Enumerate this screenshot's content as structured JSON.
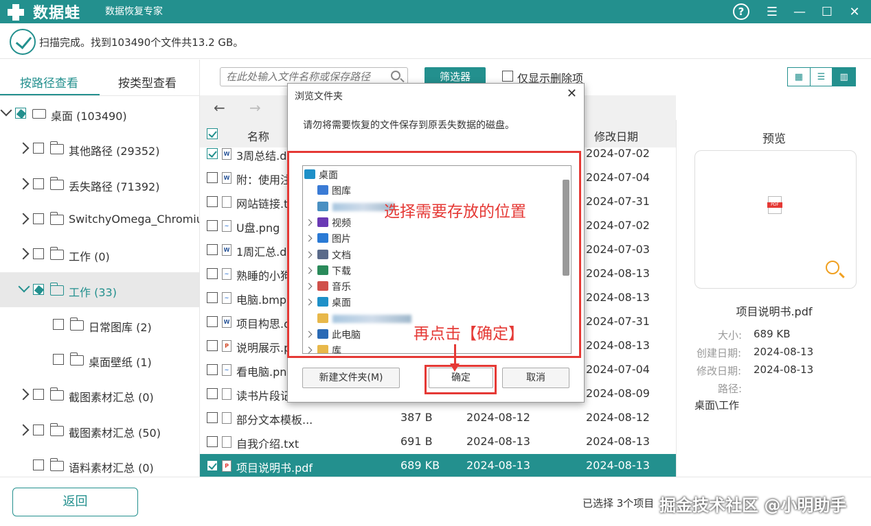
{
  "titlebar": {
    "app_name": "数据蛙",
    "subtitle": "数据恢复专家",
    "help": "?",
    "menu": "☰",
    "minimize": "—",
    "maximize": "☐",
    "close": "✕"
  },
  "status": {
    "scan_text": "扫描完成。找到103490个文件共13.2 GB。"
  },
  "left_tabs": {
    "by_path": "按路径查看",
    "by_type": "按类型查看"
  },
  "tree": [
    {
      "label": "桌面 (103490)",
      "expand": "down",
      "check": "partial",
      "icon": "drive"
    },
    {
      "label": "其他路径 (29352)",
      "expand": "right",
      "check": "none",
      "icon": "folder"
    },
    {
      "label": "丢失路径 (71392)",
      "expand": "right",
      "check": "none",
      "icon": "folder"
    },
    {
      "label": "SwitchyOmega_Chromium",
      "expand": "right",
      "check": "none",
      "icon": "folder"
    },
    {
      "label": "工作 (0)",
      "expand": "right",
      "check": "none",
      "icon": "folder"
    },
    {
      "label": "工作 (33)",
      "expand": "down",
      "check": "partial",
      "icon": "folder",
      "selected": true
    },
    {
      "label": "日常图库 (2)",
      "expand": "",
      "check": "none",
      "icon": "folder"
    },
    {
      "label": "桌面壁纸 (1)",
      "expand": "",
      "check": "none",
      "icon": "folder"
    },
    {
      "label": "截图素材汇总 (0)",
      "expand": "right",
      "check": "none",
      "icon": "folder"
    },
    {
      "label": "截图素材汇总 (50)",
      "expand": "right",
      "check": "none",
      "icon": "folder"
    },
    {
      "label": "语料素材汇总 (0)",
      "expand": "",
      "check": "none",
      "icon": "folder"
    }
  ],
  "search": {
    "placeholder": "在此处输入文件名称或保存路径"
  },
  "filter": {
    "label": "筛选器",
    "only_deleted": "仅显示删除项"
  },
  "view_icons": {
    "grid": "▦",
    "list": "☰",
    "detail": "▥"
  },
  "nav": {
    "back": "←",
    "forward": "→"
  },
  "columns": {
    "name": "名称",
    "modified": "修改日期"
  },
  "files": [
    {
      "name": "3周总结.d",
      "size": "",
      "created": "",
      "modified": "2024-07-02",
      "type": "W",
      "checked": true
    },
    {
      "name": "附：使用注",
      "size": "",
      "created": "",
      "modified": "2024-07-04",
      "type": "W",
      "checked": false
    },
    {
      "name": "网站链接.t",
      "size": "",
      "created": "",
      "modified": "2024-07-31",
      "type": "",
      "checked": false
    },
    {
      "name": "U盘.png",
      "size": "",
      "created": "",
      "modified": "2024-07-02",
      "type": "~",
      "checked": false
    },
    {
      "name": "1周汇总.d",
      "size": "",
      "created": "",
      "modified": "2024-07-03",
      "type": "W",
      "checked": false
    },
    {
      "name": "熟睡的小狗",
      "size": "",
      "created": "",
      "modified": "2024-08-13",
      "type": "~",
      "checked": false
    },
    {
      "name": "电脑.bmp",
      "size": "",
      "created": "",
      "modified": "2024-08-13",
      "type": "~",
      "checked": false
    },
    {
      "name": "项目构思.d",
      "size": "",
      "created": "",
      "modified": "2024-07-31",
      "type": "W",
      "checked": false
    },
    {
      "name": "说明展示.p",
      "size": "",
      "created": "",
      "modified": "2024-08-13",
      "type": "P",
      "checked": false
    },
    {
      "name": "看电脑.png",
      "size": "",
      "created": "",
      "modified": "2024-07-04",
      "type": "~",
      "checked": false
    },
    {
      "name": "读书片段记",
      "size": "",
      "created": "",
      "modified": "2024-08-09",
      "type": "",
      "checked": false
    },
    {
      "name": "部分文本模板...",
      "size": "387  B",
      "created": "2024-08-12",
      "modified": "2024-08-12",
      "type": "",
      "checked": false
    },
    {
      "name": "自我介绍.txt",
      "size": "691  B",
      "created": "2024-08-13",
      "modified": "2024-08-13",
      "type": "",
      "checked": false
    },
    {
      "name": "项目说明书.pdf",
      "size": "689 KB",
      "created": "2024-08-13",
      "modified": "2024-08-13",
      "type": "PDF",
      "checked": true,
      "selected": true
    }
  ],
  "preview": {
    "title": "预览",
    "filename": "项目说明书.pdf",
    "size_label": "大小:",
    "size": "689 KB",
    "created_label": "创建日期:",
    "created": "2024-08-13",
    "modified_label": "修改日期:",
    "modified": "2024-08-13",
    "path_label": "路径:",
    "path": "桌面\\工作"
  },
  "bottom": {
    "back": "返回",
    "selection": "已选择 3个项目",
    "watermark": "掘金技术社区 @小明助手"
  },
  "dialog": {
    "title": "浏览文件夹",
    "close": "✕",
    "message": "请勿将需要恢复的文件保存到原丢失数据的磁盘。",
    "tree": [
      {
        "label": "桌面",
        "level": 0,
        "expand": false,
        "icon": "desktop"
      },
      {
        "label": "图库",
        "level": 1,
        "expand": false,
        "icon": "gallery"
      },
      {
        "label": "",
        "level": 1,
        "expand": false,
        "icon": "user",
        "blurred": true
      },
      {
        "label": "视频",
        "level": 1,
        "expand": true,
        "icon": "video"
      },
      {
        "label": "图片",
        "level": 1,
        "expand": true,
        "icon": "pictures"
      },
      {
        "label": "文档",
        "level": 1,
        "expand": true,
        "icon": "docs"
      },
      {
        "label": "下载",
        "level": 1,
        "expand": true,
        "icon": "download"
      },
      {
        "label": "音乐",
        "level": 1,
        "expand": true,
        "icon": "music"
      },
      {
        "label": "桌面",
        "level": 1,
        "expand": true,
        "icon": "desktop"
      },
      {
        "label": "",
        "level": 1,
        "expand": false,
        "icon": "folder",
        "blurred": true
      },
      {
        "label": "此电脑",
        "level": 1,
        "expand": true,
        "icon": "pc"
      },
      {
        "label": "库",
        "level": 1,
        "expand": true,
        "icon": "folder"
      }
    ],
    "new_folder": "新建文件夹(M)",
    "ok": "确定",
    "cancel": "取消"
  },
  "annotations": {
    "pick_location": "选择需要存放的位置",
    "click_ok": "再点击【确定】",
    "color": "#e53935"
  },
  "colors": {
    "accent": "#23908e"
  }
}
